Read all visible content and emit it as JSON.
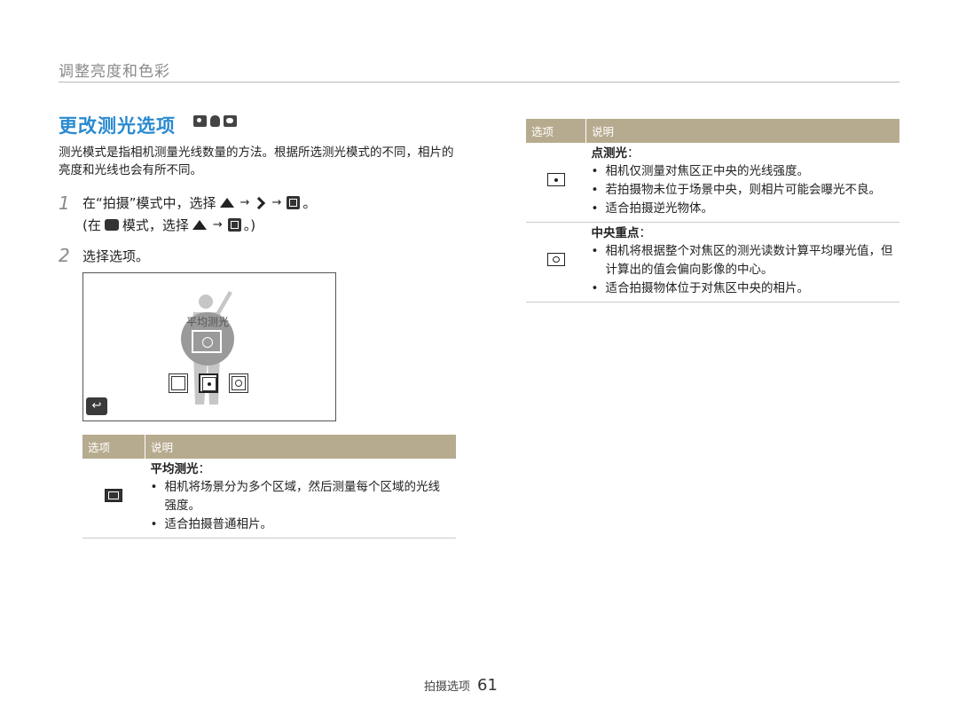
{
  "header": {
    "section_title": "调整亮度和色彩"
  },
  "title": {
    "text": "更改测光选项",
    "mode_icons": [
      "camera-icon",
      "hand-icon",
      "movie-icon"
    ]
  },
  "intro": "测光模式是指相机测量光线数量的方法。根据所选测光模式的不同，相片的亮度和光线也会有所不同。",
  "steps": [
    {
      "num": "1",
      "line1_a": "在“拍摄”模式中，选择",
      "line1_end": "。",
      "line2_a": "(在",
      "line2_b": "模式，选择",
      "line2_end": "。)"
    },
    {
      "num": "2",
      "text": "选择选项。"
    }
  ],
  "arrow": "→",
  "screen": {
    "label": "平均测光",
    "back": "↩"
  },
  "table_left": {
    "headers": [
      "选项",
      "说明"
    ],
    "rows": [
      {
        "icon": "multi-metering-icon",
        "title": "平均测光",
        "colon": "：",
        "bullets": [
          "相机将场景分为多个区域，然后测量每个区域的光线强度。",
          "适合拍摄普通相片。"
        ]
      }
    ]
  },
  "table_right": {
    "headers": [
      "选项",
      "说明"
    ],
    "rows": [
      {
        "icon": "spot-metering-icon",
        "title": "点测光",
        "colon": "：",
        "bullets": [
          "相机仅测量对焦区正中央的光线强度。",
          "若拍摄物未位于场景中央，则相片可能会曝光不良。",
          "适合拍摄逆光物体。"
        ]
      },
      {
        "icon": "center-weighted-icon",
        "title": "中央重点",
        "colon": "：",
        "bullets": [
          "相机将根据整个对焦区的测光读数计算平均曝光值，但计算出的值会偏向影像的中心。",
          "适合拍摄物体位于对焦区中央的相片。"
        ]
      }
    ]
  },
  "footer": {
    "label": "拍摄选项",
    "page": "61"
  }
}
